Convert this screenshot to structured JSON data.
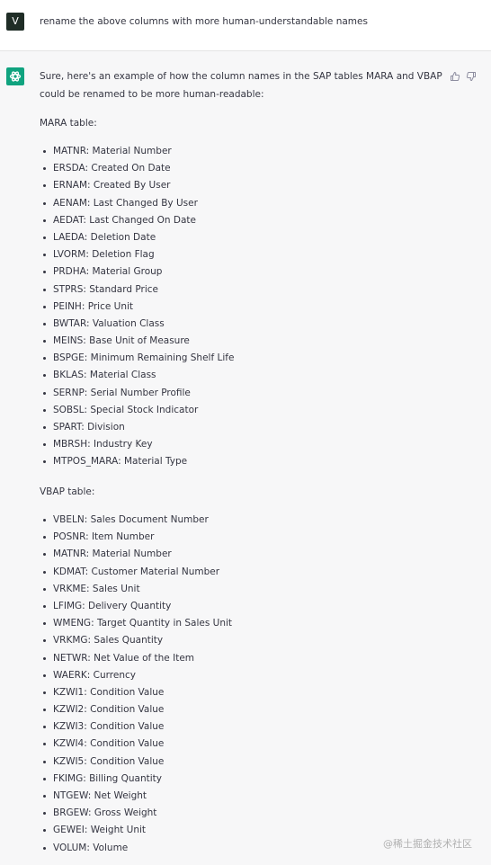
{
  "user_message": {
    "avatar_letter": "V",
    "text": "rename the above columns with more human-understandable names"
  },
  "assistant_message": {
    "intro": "Sure, here's an example of how the column names in the SAP tables MARA and VBAP could be renamed to be more human-readable:",
    "mara_heading": "MARA table:",
    "mara_items": [
      "MATNR: Material Number",
      "ERSDA: Created On Date",
      "ERNAM: Created By User",
      "AENAM: Last Changed By User",
      "AEDAT: Last Changed On Date",
      "LAEDA: Deletion Date",
      "LVORM: Deletion Flag",
      "PRDHA: Material Group",
      "STPRS: Standard Price",
      "PEINH: Price Unit",
      "BWTAR: Valuation Class",
      "MEINS: Base Unit of Measure",
      "BSPGE: Minimum Remaining Shelf Life",
      "BKLAS: Material Class",
      "SERNP: Serial Number Profile",
      "SOBSL: Special Stock Indicator",
      "SPART: Division",
      "MBRSH: Industry Key",
      "MTPOS_MARA: Material Type"
    ],
    "vbap_heading": "VBAP table:",
    "vbap_items": [
      "VBELN: Sales Document Number",
      "POSNR: Item Number",
      "MATNR: Material Number",
      "KDMAT: Customer Material Number",
      "VRKME: Sales Unit",
      "LFIMG: Delivery Quantity",
      "WMENG: Target Quantity in Sales Unit",
      "VRKMG: Sales Quantity",
      "NETWR: Net Value of the Item",
      "WAERK: Currency",
      "KZWI1: Condition Value",
      "KZWI2: Condition Value",
      "KZWI3: Condition Value",
      "KZWI4: Condition Value",
      "KZWI5: Condition Value",
      "FKIMG: Billing Quantity",
      "NTGEW: Net Weight",
      "BRGEW: Gross Weight",
      "GEWEI: Weight Unit",
      "VOLUM: Volume"
    ]
  },
  "icons": {
    "assistant_avatar": "openai-logo-icon",
    "thumbs_up": "thumbs-up-icon",
    "thumbs_down": "thumbs-down-icon"
  },
  "colors": {
    "assistant_avatar_bg": "#10a37f",
    "user_avatar_bg": "#1f2d26",
    "assistant_row_bg": "#f7f7f8",
    "text": "#343541"
  },
  "watermark": "@稀土掘金技术社区"
}
